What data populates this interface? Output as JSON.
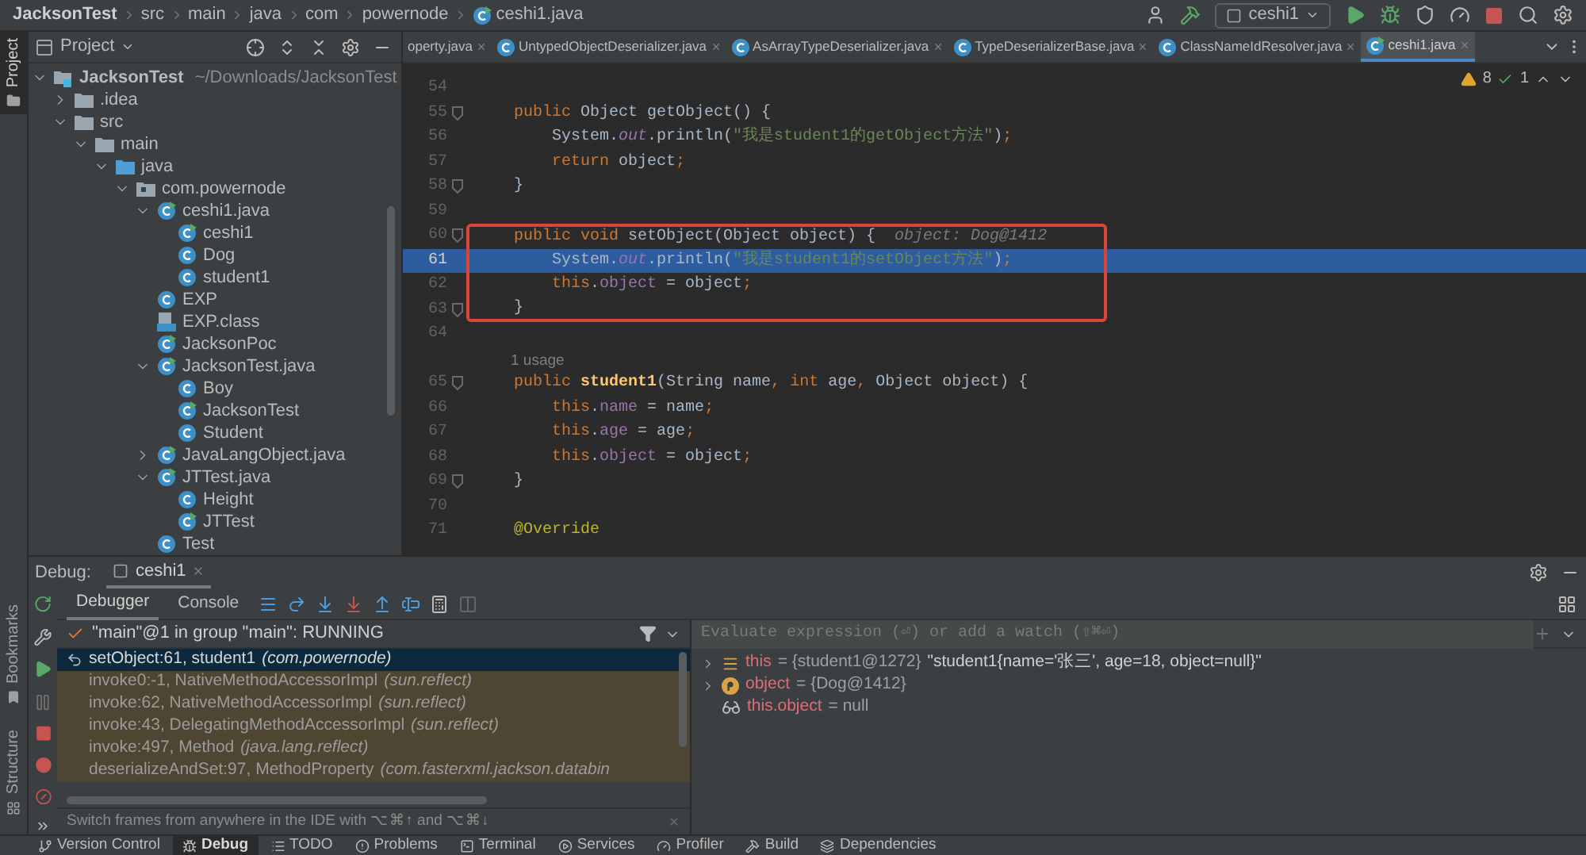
{
  "breadcrumbs": [
    "JacksonTest",
    "src",
    "main",
    "java",
    "com",
    "powernode",
    "ceshi1.java"
  ],
  "run_config": "ceshi1",
  "side_stripe": [
    {
      "label": "Project",
      "selected": true
    },
    {
      "label": "Bookmarks",
      "selected": false
    },
    {
      "label": "Structure",
      "selected": false
    }
  ],
  "project_panel": {
    "title": "Project",
    "tree": [
      {
        "label": "JacksonTest",
        "detail": "~/Downloads/JacksonTest",
        "kind": "module",
        "expanded": true,
        "children": [
          {
            "label": ".idea",
            "kind": "folder",
            "expanded": false
          },
          {
            "label": "src",
            "kind": "folder",
            "expanded": true,
            "children": [
              {
                "label": "main",
                "kind": "folder",
                "expanded": true,
                "children": [
                  {
                    "label": "java",
                    "kind": "source-folder",
                    "expanded": true,
                    "children": [
                      {
                        "label": "com.powernode",
                        "kind": "package",
                        "expanded": true,
                        "children": [
                          {
                            "label": "ceshi1.java",
                            "kind": "java-file",
                            "expanded": true,
                            "children": [
                              {
                                "label": "ceshi1",
                                "kind": "main-class"
                              },
                              {
                                "label": "Dog",
                                "kind": "class"
                              },
                              {
                                "label": "student1",
                                "kind": "class"
                              }
                            ]
                          },
                          {
                            "label": "EXP",
                            "kind": "class"
                          },
                          {
                            "label": "EXP.class",
                            "kind": "class-file"
                          },
                          {
                            "label": "JacksonPoc",
                            "kind": "main-class"
                          },
                          {
                            "label": "JacksonTest.java",
                            "kind": "java-file",
                            "expanded": true,
                            "children": [
                              {
                                "label": "Boy",
                                "kind": "class"
                              },
                              {
                                "label": "JacksonTest",
                                "kind": "main-class"
                              },
                              {
                                "label": "Student",
                                "kind": "class"
                              }
                            ]
                          },
                          {
                            "label": "JavaLangObject.java",
                            "kind": "java-file",
                            "expanded": false
                          },
                          {
                            "label": "JTTest.java",
                            "kind": "java-file",
                            "expanded": true,
                            "children": [
                              {
                                "label": "Height",
                                "kind": "class"
                              },
                              {
                                "label": "JTTest",
                                "kind": "main-class"
                              }
                            ]
                          },
                          {
                            "label": "Test",
                            "kind": "class"
                          }
                        ]
                      }
                    ]
                  }
                ]
              }
            ]
          }
        ]
      }
    ]
  },
  "editor": {
    "tabs": [
      {
        "label": "operty.java",
        "selected": false
      },
      {
        "label": "UntypedObjectDeserializer.java",
        "selected": false
      },
      {
        "label": "AsArrayTypeDeserializer.java",
        "selected": false
      },
      {
        "label": "TypeDeserializerBase.java",
        "selected": false
      },
      {
        "label": "ClassNameIdResolver.java",
        "selected": false
      },
      {
        "label": "ceshi1.java",
        "selected": true
      }
    ],
    "warnings": "8",
    "typos": "1",
    "lines": [
      {
        "kind": "code",
        "number": "54",
        "fold": false,
        "boxed": false,
        "current": false
      },
      {
        "kind": "code",
        "number": "55",
        "fold": true,
        "boxed": false,
        "current": false,
        "tokens": [
          {
            "kind": "keyword",
            "text": "    public "
          },
          {
            "kind": "plain",
            "text": "Object getObject() {"
          }
        ]
      },
      {
        "kind": "code",
        "number": "56",
        "fold": false,
        "boxed": false,
        "current": false,
        "tokens": [
          {
            "kind": "plain",
            "text": "        System."
          },
          {
            "kind": "static",
            "text": "out"
          },
          {
            "kind": "plain",
            "text": ".println("
          },
          {
            "kind": "string",
            "text": "\"我是student1的getObject方法\""
          },
          {
            "kind": "plain",
            "text": ")"
          },
          {
            "kind": "punct",
            "text": ";"
          }
        ]
      },
      {
        "kind": "code",
        "number": "57",
        "fold": false,
        "boxed": false,
        "current": false,
        "tokens": [
          {
            "kind": "keyword",
            "text": "        return "
          },
          {
            "kind": "plain",
            "text": "object"
          },
          {
            "kind": "punct",
            "text": ";"
          }
        ]
      },
      {
        "kind": "code",
        "number": "58",
        "fold": true,
        "boxed": false,
        "current": false,
        "tokens": [
          {
            "kind": "plain",
            "text": "    }"
          }
        ]
      },
      {
        "kind": "code",
        "number": "59",
        "fold": false,
        "boxed": false,
        "current": false
      },
      {
        "kind": "code",
        "number": "60",
        "fold": true,
        "boxed": true,
        "current": false,
        "tokens": [
          {
            "kind": "keyword",
            "text": "    public void "
          },
          {
            "kind": "plain",
            "text": "setObject(Object object) {"
          },
          {
            "kind": "inlay",
            "text": "  object: Dog@1412"
          }
        ]
      },
      {
        "kind": "code",
        "number": "61",
        "fold": false,
        "boxed": true,
        "current": true,
        "tokens": [
          {
            "kind": "plain",
            "text": "        System."
          },
          {
            "kind": "static",
            "text": "out"
          },
          {
            "kind": "plain",
            "text": ".println("
          },
          {
            "kind": "string",
            "text": "\"我是student1的setObject方法\""
          },
          {
            "kind": "plain",
            "text": ")"
          },
          {
            "kind": "punct",
            "text": ";"
          }
        ]
      },
      {
        "kind": "code",
        "number": "62",
        "fold": false,
        "boxed": true,
        "current": false,
        "tokens": [
          {
            "kind": "keyword",
            "text": "        this"
          },
          {
            "kind": "plain",
            "text": "."
          },
          {
            "kind": "field",
            "text": "object"
          },
          {
            "kind": "plain",
            "text": " = object"
          },
          {
            "kind": "punct",
            "text": ";"
          }
        ]
      },
      {
        "kind": "code",
        "number": "63",
        "fold": true,
        "boxed": true,
        "current": false,
        "tokens": [
          {
            "kind": "plain",
            "text": "    }"
          }
        ]
      },
      {
        "kind": "code",
        "number": "64",
        "fold": false,
        "boxed": false,
        "current": false
      },
      {
        "kind": "usage",
        "text": "1 usage"
      },
      {
        "kind": "code",
        "number": "65",
        "fold": true,
        "boxed": false,
        "current": false,
        "tokens": [
          {
            "kind": "keyword",
            "text": "    public "
          },
          {
            "kind": "method",
            "text": "student1"
          },
          {
            "kind": "plain",
            "text": "(String name"
          },
          {
            "kind": "punct",
            "text": ", "
          },
          {
            "kind": "keyword",
            "text": "int "
          },
          {
            "kind": "plain",
            "text": "age"
          },
          {
            "kind": "punct",
            "text": ", "
          },
          {
            "kind": "plain",
            "text": "Object object) {"
          }
        ]
      },
      {
        "kind": "code",
        "number": "66",
        "fold": false,
        "boxed": false,
        "current": false,
        "tokens": [
          {
            "kind": "keyword",
            "text": "        this"
          },
          {
            "kind": "plain",
            "text": "."
          },
          {
            "kind": "field",
            "text": "name"
          },
          {
            "kind": "plain",
            "text": " = name"
          },
          {
            "kind": "punct",
            "text": ";"
          }
        ]
      },
      {
        "kind": "code",
        "number": "67",
        "fold": false,
        "boxed": false,
        "current": false,
        "tokens": [
          {
            "kind": "keyword",
            "text": "        this"
          },
          {
            "kind": "plain",
            "text": "."
          },
          {
            "kind": "field",
            "text": "age"
          },
          {
            "kind": "plain",
            "text": " = age"
          },
          {
            "kind": "punct",
            "text": ";"
          }
        ]
      },
      {
        "kind": "code",
        "number": "68",
        "fold": false,
        "boxed": false,
        "current": false,
        "tokens": [
          {
            "kind": "keyword",
            "text": "        this"
          },
          {
            "kind": "plain",
            "text": "."
          },
          {
            "kind": "field",
            "text": "object"
          },
          {
            "kind": "plain",
            "text": " = object"
          },
          {
            "kind": "punct",
            "text": ";"
          }
        ]
      },
      {
        "kind": "code",
        "number": "69",
        "fold": true,
        "boxed": false,
        "current": false,
        "tokens": [
          {
            "kind": "plain",
            "text": "    }"
          }
        ]
      },
      {
        "kind": "code",
        "number": "70",
        "fold": false,
        "boxed": false,
        "current": false
      },
      {
        "kind": "code",
        "number": "71",
        "fold": false,
        "boxed": false,
        "current": false,
        "tokens": [
          {
            "kind": "annotation",
            "text": "    @Override"
          }
        ]
      }
    ]
  },
  "debug": {
    "label": "Debug:",
    "session_tab": "ceshi1",
    "tabs": [
      {
        "label": "Debugger",
        "selected": true
      },
      {
        "label": "Console",
        "selected": false
      }
    ],
    "thread": "\"main\"@1 in group \"main\": RUNNING",
    "frames": [
      {
        "method": "setObject:61, student1",
        "package": "(com.powernode)",
        "kind": "user",
        "selected": true
      },
      {
        "method": "invoke0:-1, NativeMethodAccessorImpl",
        "package": "(sun.reflect)",
        "kind": "library",
        "selected": false
      },
      {
        "method": "invoke:62, NativeMethodAccessorImpl",
        "package": "(sun.reflect)",
        "kind": "library",
        "selected": false
      },
      {
        "method": "invoke:43, DelegatingMethodAccessorImpl",
        "package": "(sun.reflect)",
        "kind": "library",
        "selected": false
      },
      {
        "method": "invoke:497, Method",
        "package": "(java.lang.reflect)",
        "kind": "library",
        "selected": false
      },
      {
        "method": "deserializeAndSet:97, MethodProperty",
        "package": "(com.fasterxml.jackson.databin",
        "kind": "library",
        "selected": false
      }
    ],
    "hint": "Switch frames from anywhere in the IDE with ⌥⌘↑ and ⌥⌘↓",
    "evaluate_placeholder": "Evaluate expression (⏎) or add a watch (⇧⌘⏎)",
    "variables": [
      {
        "kind": "field",
        "name": "this",
        "value": "= {student1@1272}",
        "detail": "\"student1{name='张三', age=18, object=null}\"",
        "expandable": true
      },
      {
        "kind": "parameter",
        "name": "object",
        "value": "= {Dog@1412}",
        "expandable": true
      },
      {
        "kind": "watch",
        "name": "this.object",
        "value": "= null",
        "expandable": false
      }
    ]
  },
  "tool_windows": [
    {
      "kind": "vcs",
      "label": "Version Control",
      "selected": false
    },
    {
      "kind": "debug",
      "label": "Debug",
      "selected": true
    },
    {
      "kind": "todo",
      "label": "TODO",
      "selected": false
    },
    {
      "kind": "problems",
      "label": "Problems",
      "selected": false
    },
    {
      "kind": "terminal",
      "label": "Terminal",
      "selected": false
    },
    {
      "kind": "services",
      "label": "Services",
      "selected": false
    },
    {
      "kind": "profiler",
      "label": "Profiler",
      "selected": false
    },
    {
      "kind": "build",
      "label": "Build",
      "selected": false
    },
    {
      "kind": "dependencies",
      "label": "Dependencies",
      "selected": false
    }
  ]
}
